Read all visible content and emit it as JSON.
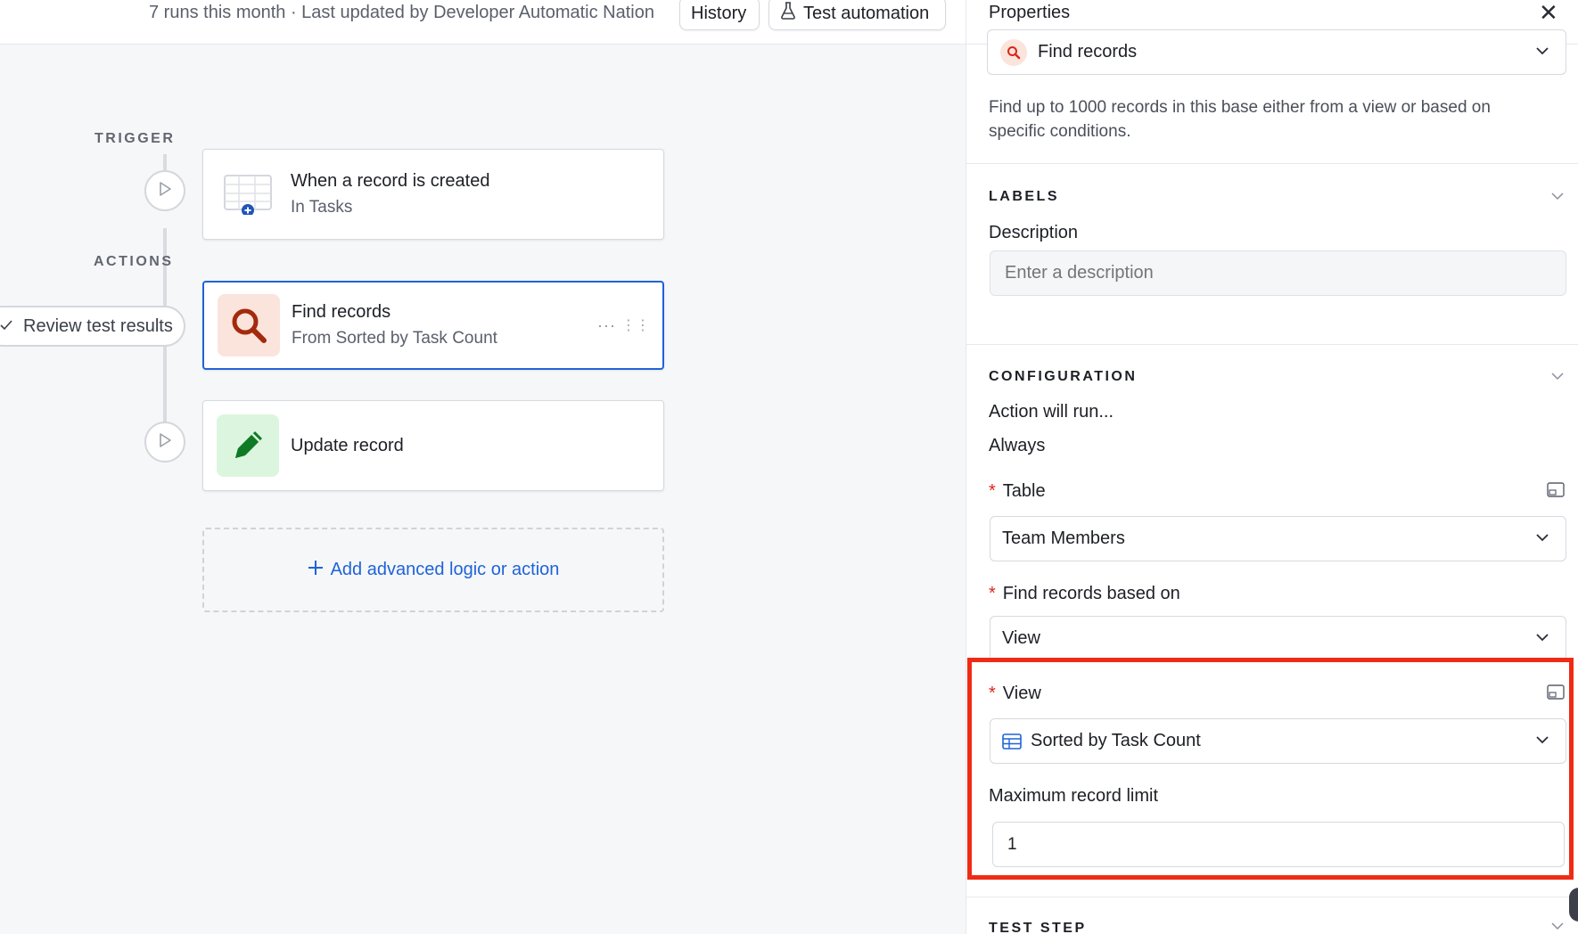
{
  "topbar": {
    "runs_text": "7 runs this month · Last updated by Developer Automatic Nation",
    "history_label": "History",
    "test_label": "Test automation"
  },
  "canvas": {
    "trigger_label": "TRIGGER",
    "actions_label": "ACTIONS",
    "review_label": "Review test results",
    "trigger_card": {
      "title": "When a record is created",
      "subtitle": "In Tasks"
    },
    "find_card": {
      "title": "Find records",
      "subtitle": "From Sorted by Task Count",
      "more": "···"
    },
    "update_card": {
      "title": "Update record"
    },
    "add_label": "Add advanced logic or action"
  },
  "panel": {
    "title": "Properties",
    "action_select": "Find records",
    "description": "Find up to 1000 records in this base either from a view or based on specific conditions.",
    "labels_section": "LABELS",
    "description_label": "Description",
    "description_placeholder": "Enter a description",
    "configuration_section": "CONFIGURATION",
    "action_will_run": "Action will run...",
    "run_condition": "Always",
    "table_label": "Table",
    "table_value": "Team Members",
    "find_based_label": "Find records based on",
    "find_based_value": "View",
    "view_label": "View",
    "view_value": "Sorted by Task Count",
    "max_limit_label": "Maximum record limit",
    "max_limit_value": "1",
    "test_step_section": "TEST STEP"
  },
  "colors": {
    "accent": "#1f63d8",
    "highlight": "#ef2b16",
    "required": "#d9261c",
    "find_icon": "#a32a0c",
    "update_icon": "#0f7a24"
  }
}
